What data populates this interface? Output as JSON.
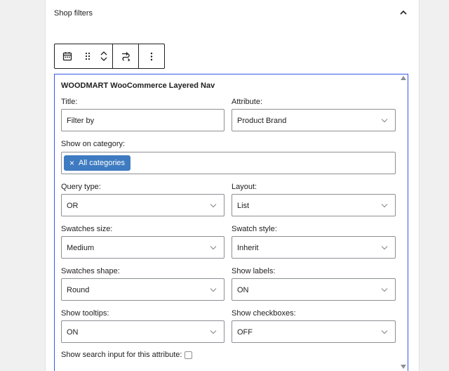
{
  "panel": {
    "title": "Shop filters"
  },
  "block": {
    "title": "WOODMART WooCommerce Layered Nav",
    "fields": {
      "title": {
        "label": "Title:",
        "value": "Filter by"
      },
      "attribute": {
        "label": "Attribute:",
        "value": "Product Brand"
      },
      "category": {
        "label": "Show on category:",
        "chip": "All categories",
        "chip_remove": "×"
      },
      "query_type": {
        "label": "Query type:",
        "value": "OR"
      },
      "layout": {
        "label": "Layout:",
        "value": "List"
      },
      "swatches_size": {
        "label": "Swatches size:",
        "value": "Medium"
      },
      "swatch_style": {
        "label": "Swatch style:",
        "value": "Inherit"
      },
      "swatches_shape": {
        "label": "Swatches shape:",
        "value": "Round"
      },
      "show_labels": {
        "label": "Show labels:",
        "value": "ON"
      },
      "show_tooltips": {
        "label": "Show tooltips:",
        "value": "ON"
      },
      "show_checkboxes": {
        "label": "Show checkboxes:",
        "value": "OFF"
      },
      "search_input": {
        "label": "Show search input for this attribute:",
        "checked": false
      }
    }
  },
  "icons": [
    "chevron-up-icon",
    "calendar-icon",
    "drag-handle-icon",
    "chevron-up-icon",
    "chevron-down-icon",
    "transform-icon",
    "more-options-icon",
    "scroll-up-icon",
    "scroll-down-icon",
    "chevron-down-icon"
  ],
  "colors": {
    "accent": "#3858e9",
    "chip": "#3e7bc0",
    "border": "#8c8f94",
    "background": "#f0f0f1"
  }
}
